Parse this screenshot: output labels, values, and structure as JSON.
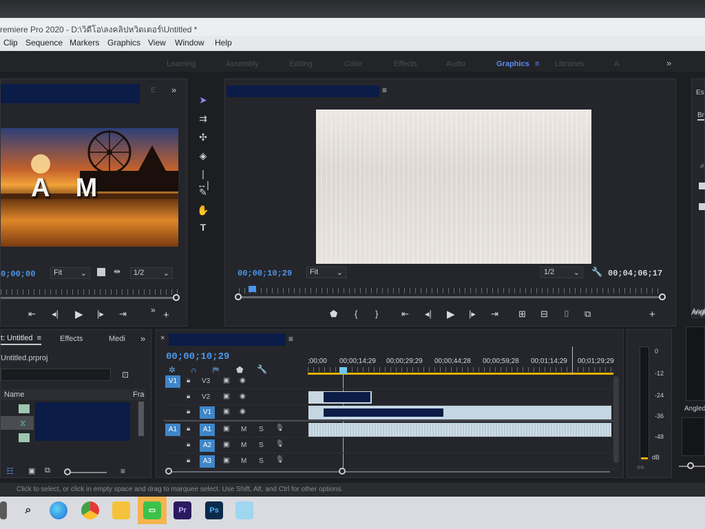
{
  "window": {
    "title": "remiere Pro 2020 - D:\\วิดีโอ\\ลงคลิปหวิดเตอร์\\Untitled *"
  },
  "menu": [
    "Clip",
    "Sequence",
    "Markers",
    "Graphics",
    "View",
    "Window",
    "Help"
  ],
  "workspaces": [
    "Learning",
    "Assembly",
    "Editing",
    "Color",
    "Effects",
    "Audio",
    "Graphics",
    "Libraries",
    "A"
  ],
  "active_workspace": "Graphics",
  "source_monitor": {
    "timecode": "0;00;00",
    "fit": "Fit",
    "resolution": "1/2",
    "thumbnail_text": "A M"
  },
  "program_monitor": {
    "timecode": "00;00;10;29",
    "fit": "Fit",
    "resolution": "1/2",
    "duration": "00;04;06;17"
  },
  "project_panel": {
    "tabs": [
      "t: Untitled",
      "Effects",
      "Medi"
    ],
    "filename": "Untitled.prproj",
    "col_name": "Name",
    "col_fra": "Fra"
  },
  "timeline": {
    "timecode": "00;00;10;29",
    "ruler": [
      ";00;00",
      "00;00;14;29",
      "00;00;29;29",
      "00;00;44;28",
      "00;00;59;28",
      "00;01;14;29",
      "00;01;29;29"
    ],
    "video_tracks": [
      {
        "src": "V1",
        "name": "V3"
      },
      {
        "src": "",
        "name": "V2"
      },
      {
        "src": "",
        "name": "V1"
      }
    ],
    "audio_tracks": [
      {
        "src": "A1",
        "name": "A1"
      },
      {
        "src": "",
        "name": "A2"
      },
      {
        "src": "",
        "name": "A3"
      }
    ],
    "track_buttons": {
      "mute": "M",
      "solo": "S"
    }
  },
  "audio_meter": {
    "scale": [
      "0",
      "-12",
      "-24",
      "-36",
      "-48",
      "dB"
    ],
    "bottom": "○○"
  },
  "right_panel": {
    "partial_labels": [
      "Es",
      "Br",
      "Angle",
      "Angled"
    ]
  },
  "status_text": "Click to select, or click in empty space and drag to marquee select. Use Shift, Alt, and Ctrl for other options.",
  "taskbar": {
    "icons": [
      "windows-icon",
      "search-icon",
      "edge-icon",
      "chrome-icon",
      "folder-icon",
      "line-icon",
      "premiere-icon",
      "photoshop-icon",
      "app-icon"
    ],
    "pr_label": "Pr",
    "ps_label": "Ps"
  },
  "colors": {
    "accent": "#4b96ee",
    "playhead": "#6ec6ee",
    "work_bar": "#e8b100",
    "clip_audio": "#c4d6e2",
    "redaction": "#0a1c47"
  }
}
